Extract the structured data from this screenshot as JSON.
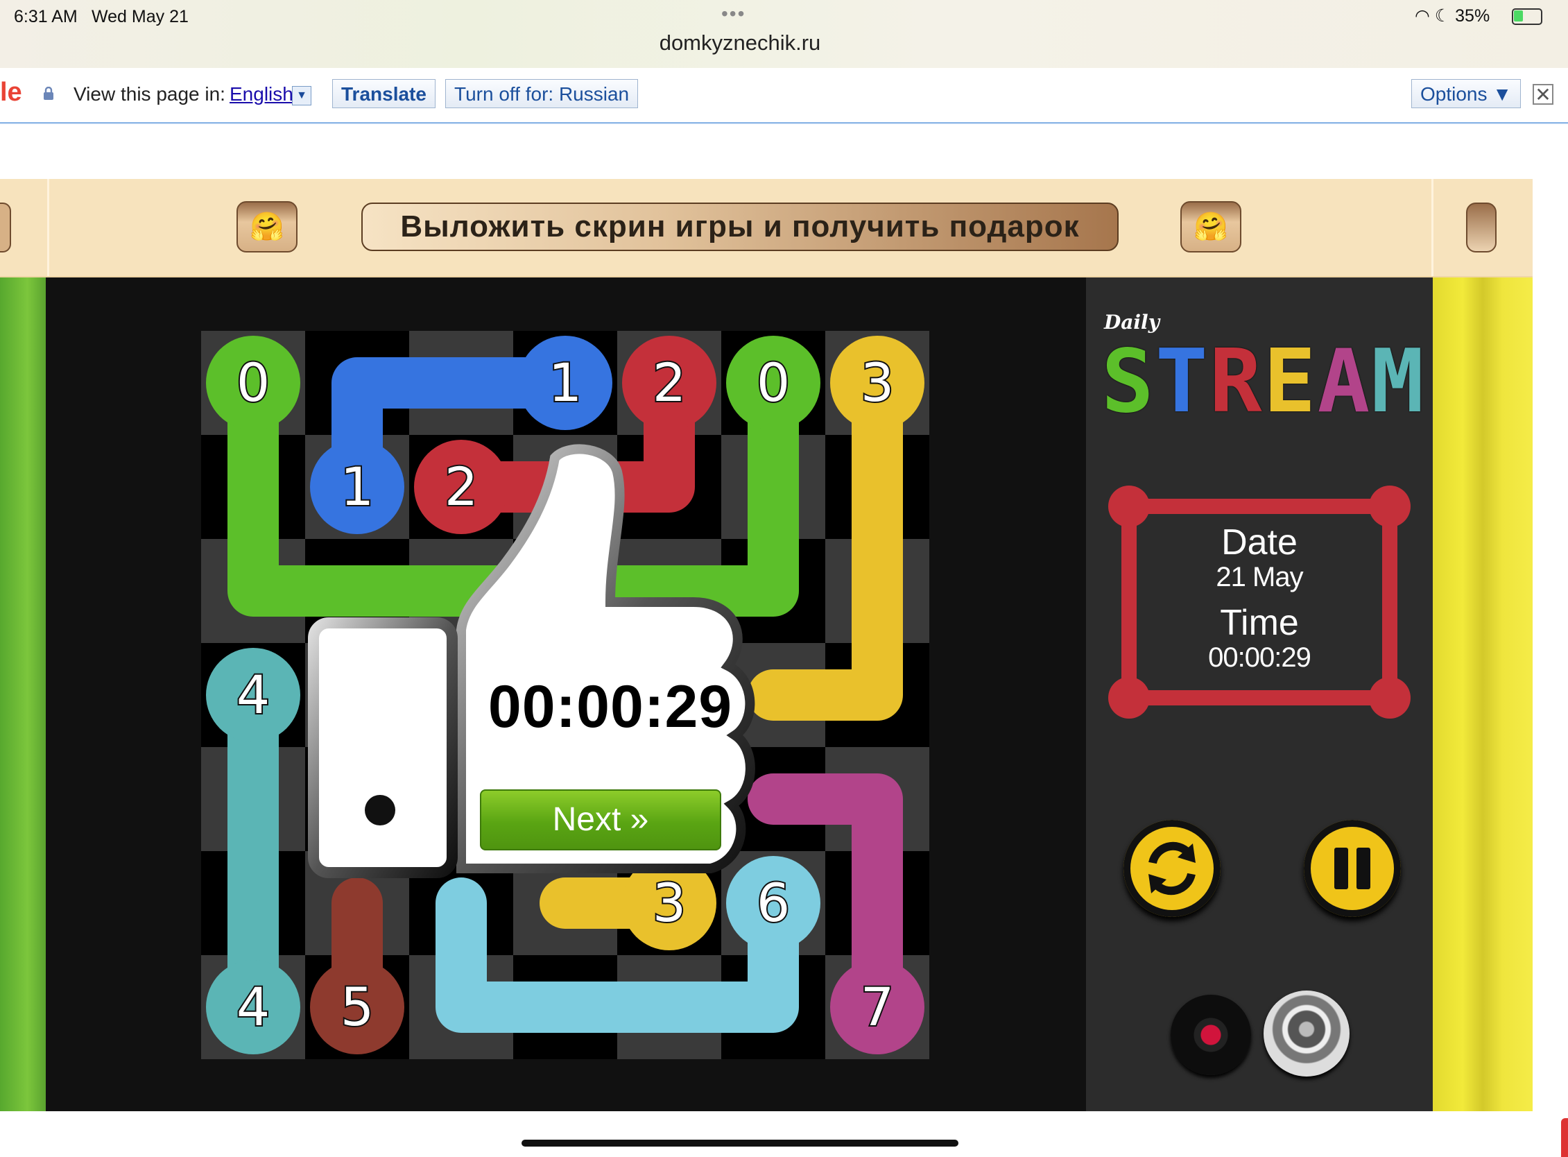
{
  "status_bar": {
    "time": "6:31 AM",
    "date": "Wed May 21",
    "url": "domkyznechik.ru",
    "battery": "35%",
    "battery_level": 0.35
  },
  "translate_bar": {
    "logo_fragment": "le",
    "view_label": "View this page in:",
    "language": "English",
    "translate_button": "Translate",
    "turn_off_button": "Turn off for: Russian",
    "options_button": "Options ▼",
    "close": "✕"
  },
  "header": {
    "share_banner": "Выложить скрин игры и получить подарок",
    "emoji": "🤗"
  },
  "logo": {
    "daily": "Daily",
    "stream": "STREAM"
  },
  "info": {
    "date_label": "Date",
    "date_value": "21 May",
    "time_label": "Time",
    "time_value": "00:00:29"
  },
  "overlay": {
    "completion_time": "00:00:29",
    "next_button": "Next »"
  },
  "board": {
    "size": 7,
    "dots": [
      {
        "label": "0",
        "color": "#5cbf2a",
        "col": 0,
        "row": 0
      },
      {
        "label": "1",
        "color": "#3674e0",
        "col": 3,
        "row": 0
      },
      {
        "label": "2",
        "color": "#c4303a",
        "col": 4,
        "row": 0
      },
      {
        "label": "0",
        "color": "#5cbf2a",
        "col": 5,
        "row": 0
      },
      {
        "label": "3",
        "color": "#e9c12c",
        "col": 6,
        "row": 0
      },
      {
        "label": "1",
        "color": "#3674e0",
        "col": 1,
        "row": 1
      },
      {
        "label": "2",
        "color": "#c4303a",
        "col": 2,
        "row": 1
      },
      {
        "label": "4",
        "color": "#5bb5b5",
        "col": 0,
        "row": 3
      },
      {
        "label": "6",
        "color": "#7ecde0",
        "col": 5,
        "row": 5
      },
      {
        "label": "3",
        "color": "#e9c12c",
        "col": 4,
        "row": 5
      },
      {
        "label": "4",
        "color": "#5bb5b5",
        "col": 0,
        "row": 6
      },
      {
        "label": "5",
        "color": "#8e3a2e",
        "col": 1,
        "row": 6
      },
      {
        "label": "7",
        "color": "#b2448a",
        "col": 6,
        "row": 6
      }
    ],
    "paths": [
      {
        "color": "#5cbf2a",
        "cells": [
          [
            0,
            0
          ],
          [
            0,
            1
          ],
          [
            0,
            2
          ],
          [
            1,
            2
          ],
          [
            2,
            2
          ],
          [
            3,
            2
          ],
          [
            4,
            2
          ],
          [
            5,
            2
          ],
          [
            5,
            1
          ],
          [
            5,
            0
          ]
        ]
      },
      {
        "color": "#3674e0",
        "cells": [
          [
            1,
            1
          ],
          [
            1,
            0
          ],
          [
            2,
            0
          ],
          [
            3,
            0
          ]
        ]
      },
      {
        "color": "#c4303a",
        "cells": [
          [
            2,
            1
          ],
          [
            3,
            1
          ],
          [
            4,
            1
          ],
          [
            4,
            0
          ]
        ]
      },
      {
        "color": "#e9c12c",
        "cells": [
          [
            6,
            0
          ],
          [
            6,
            1
          ],
          [
            6,
            2
          ],
          [
            6,
            3
          ],
          [
            5,
            3
          ]
        ]
      },
      {
        "color": "#5bb5b5",
        "cells": [
          [
            0,
            3
          ],
          [
            0,
            4
          ],
          [
            0,
            5
          ],
          [
            0,
            6
          ]
        ]
      },
      {
        "color": "#8e3a2e",
        "cells": [
          [
            1,
            5
          ],
          [
            1,
            6
          ]
        ]
      },
      {
        "color": "#7ecde0",
        "cells": [
          [
            2,
            5
          ],
          [
            2,
            6
          ],
          [
            3,
            6
          ],
          [
            4,
            6
          ],
          [
            5,
            6
          ],
          [
            5,
            5
          ]
        ]
      },
      {
        "color": "#e9c12c",
        "cells": [
          [
            3,
            5
          ],
          [
            4,
            5
          ]
        ]
      },
      {
        "color": "#b2448a",
        "cells": [
          [
            5,
            4
          ],
          [
            6,
            4
          ],
          [
            6,
            5
          ],
          [
            6,
            6
          ]
        ]
      }
    ]
  },
  "colors": {
    "accent_red": "#c4303a",
    "control_yellow": "#f0c419",
    "next_green": "#5aa513"
  },
  "icons": {
    "reset": "reset-icon",
    "pause": "pause-icon",
    "record": "record-icon",
    "speaker": "speaker-icon"
  }
}
